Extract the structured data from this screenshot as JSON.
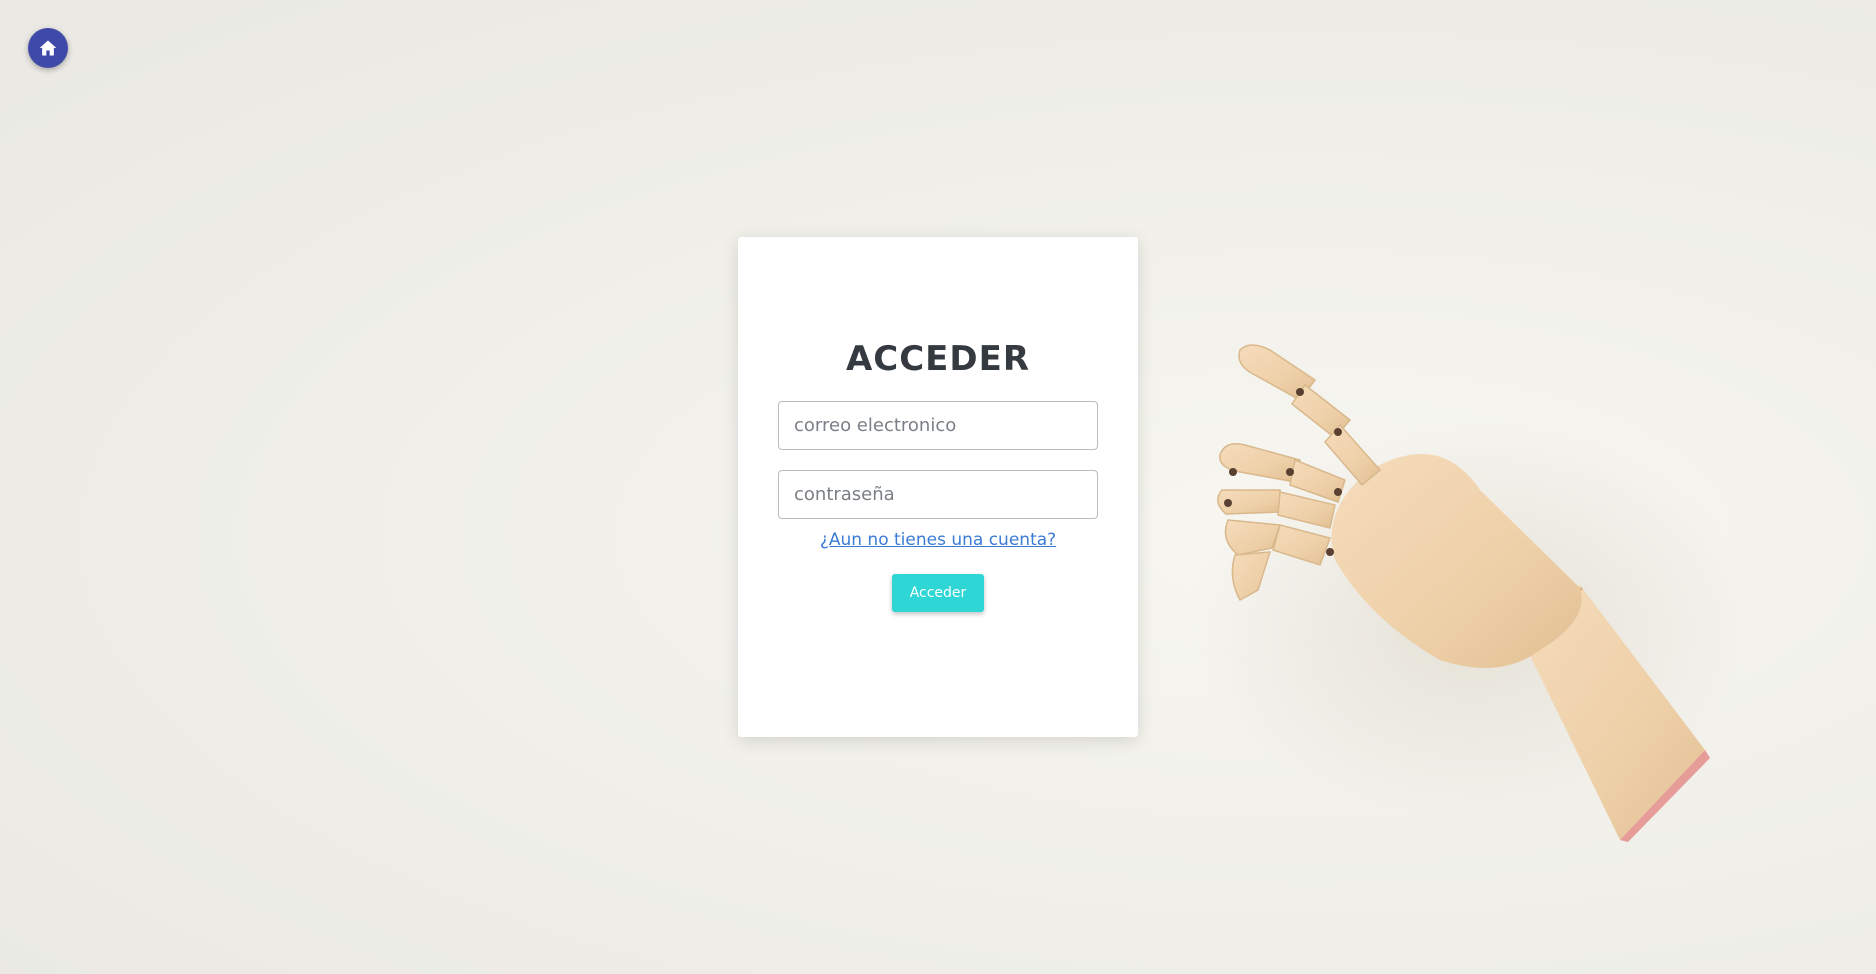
{
  "header": {
    "home_icon": "home-icon"
  },
  "login": {
    "title": "ACCEDER",
    "email_placeholder": "correo electronico",
    "email_value": "",
    "password_placeholder": "contraseña",
    "password_value": "",
    "signup_link": "¿Aun no tienes una cuenta?",
    "submit_label": "Acceder"
  },
  "colors": {
    "home_button": "#3f4aa8",
    "submit_button": "#2fd6d6",
    "link": "#3a7bd5",
    "title": "#343a40"
  }
}
